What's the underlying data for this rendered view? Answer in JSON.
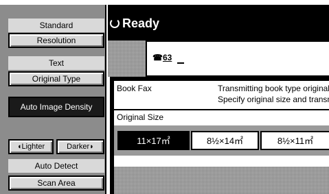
{
  "left_panel": {
    "standard_label": "Standard",
    "resolution_button": "Resolution",
    "text_label": "Text",
    "original_type_button": "Original Type",
    "auto_density_button": "Auto Image Density",
    "lighter_button": "Lighter",
    "darker_button": "Darker",
    "auto_detect_label": "Auto Detect",
    "scan_area_button": "Scan Area"
  },
  "header": {
    "status": "Ready"
  },
  "line": {
    "number": "63",
    "value": "_"
  },
  "dialog": {
    "title": "Book Fax",
    "desc_line1": "Transmitting book type original",
    "desc_line2": "Specify original size and transm",
    "size_label": "Original Size",
    "sizes": [
      "11×17㎡",
      "8½×14㎡",
      "8½×11㎡"
    ]
  }
}
